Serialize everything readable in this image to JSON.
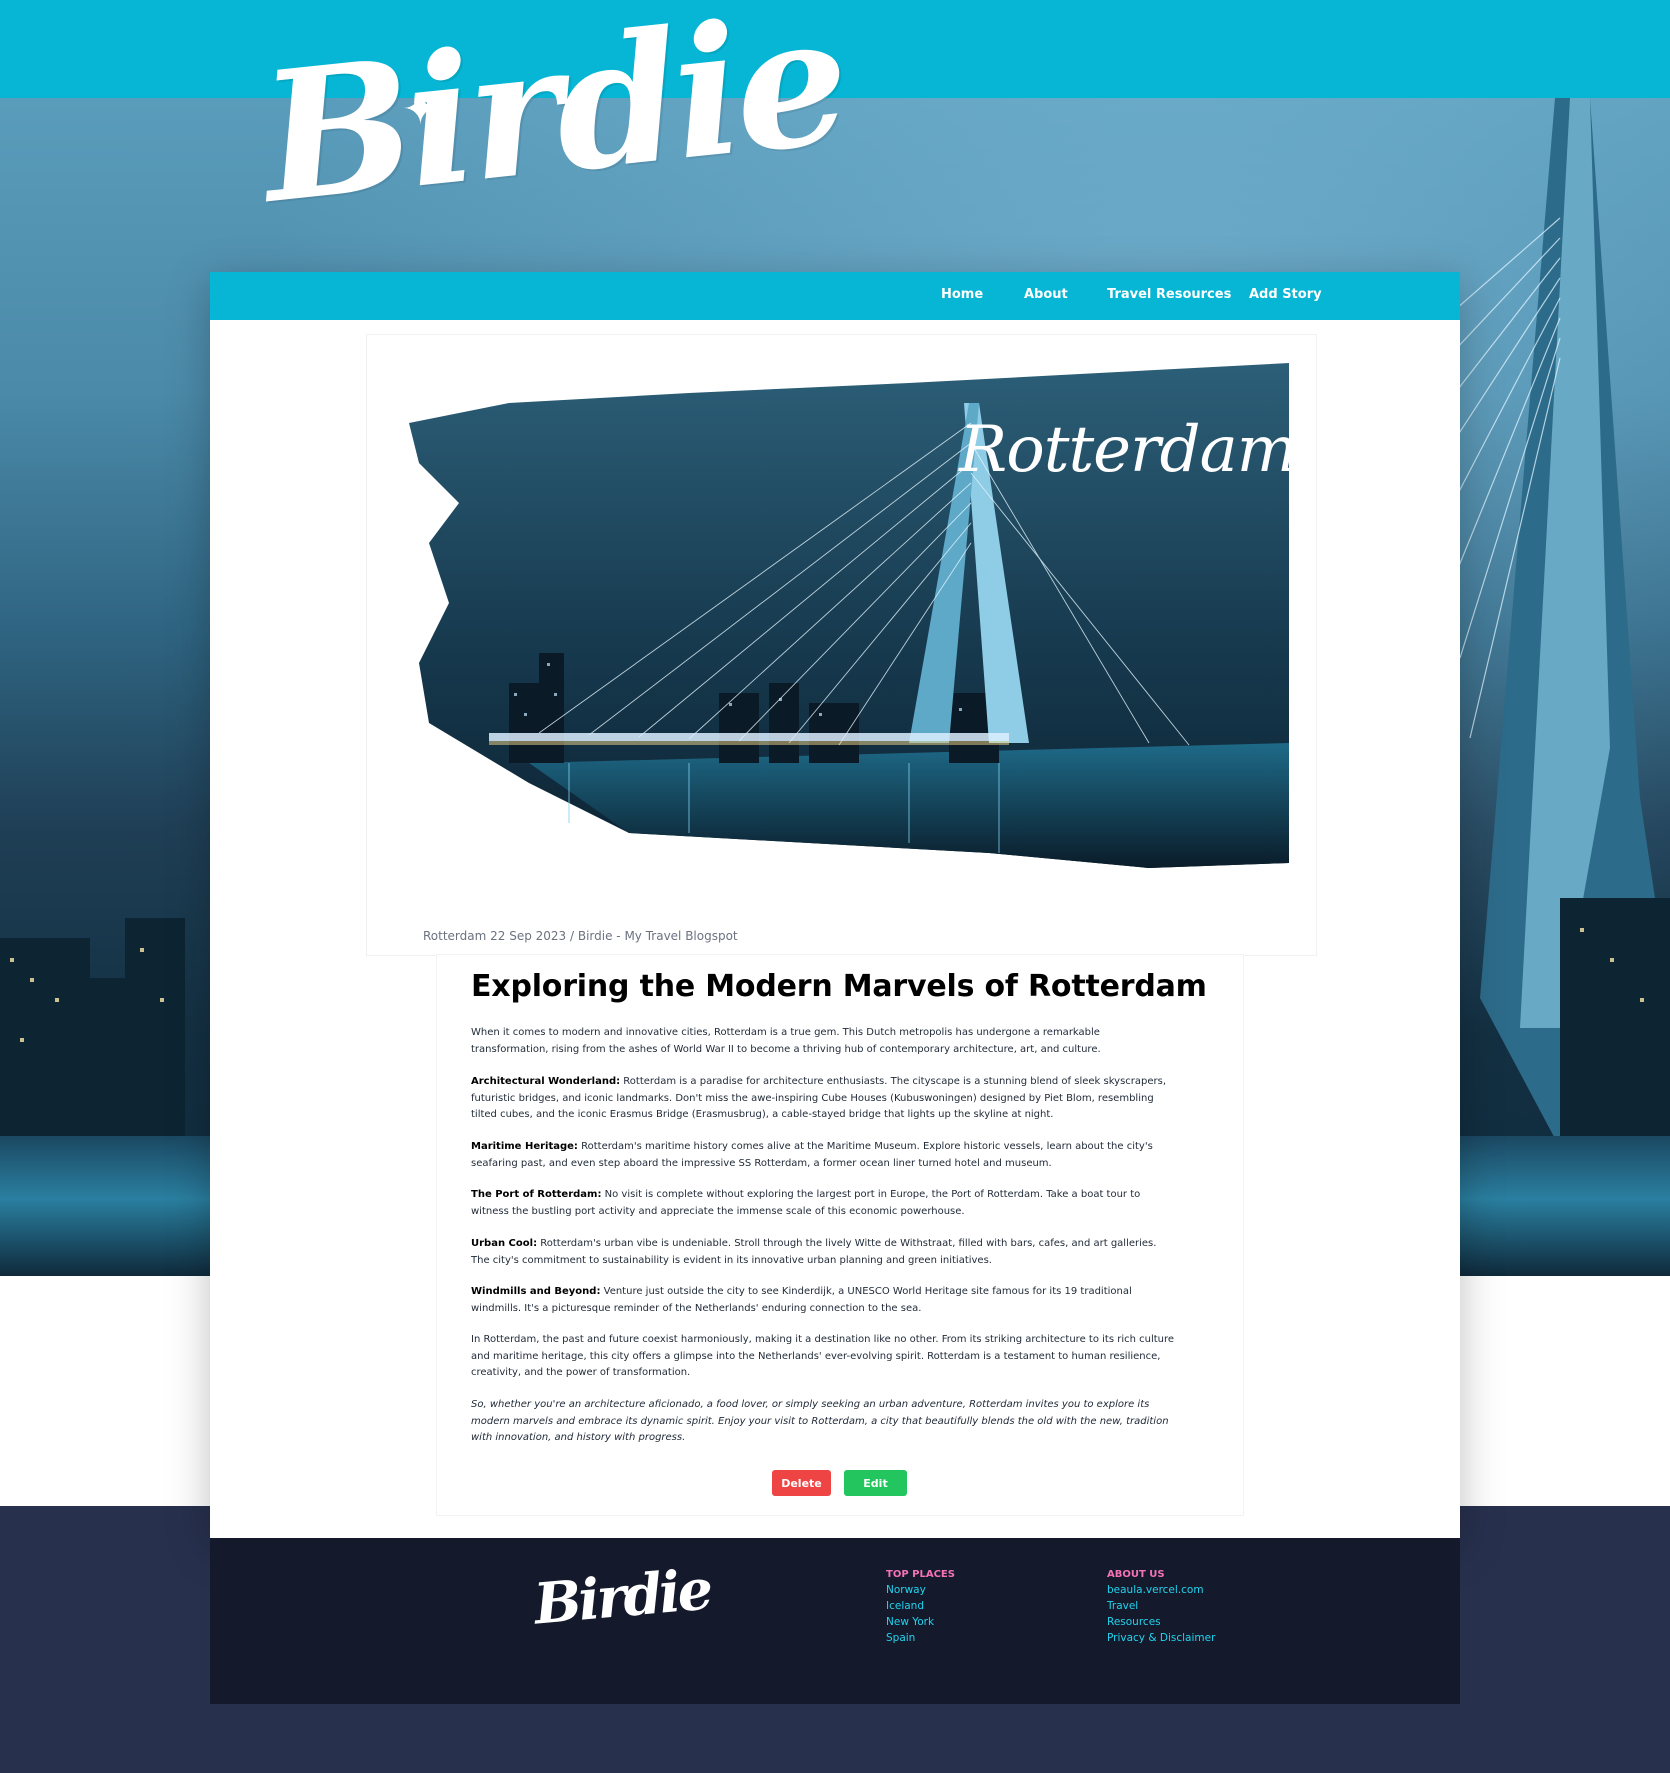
{
  "brand": {
    "name": "Birdie"
  },
  "nav": {
    "home": "Home",
    "about": "About",
    "travel_resources": "Travel Resources",
    "add_story": "Add Story"
  },
  "hero": {
    "image_title": "Rotterdam"
  },
  "post": {
    "meta": "Rotterdam  22 Sep 2023 / Birdie - My Travel Blogspot",
    "title": "Exploring the Modern Marvels of Rotterdam",
    "intro": "When it comes to modern and innovative cities, Rotterdam is a true gem. This Dutch metropolis has undergone a remarkable transformation, rising from the ashes of World War II to become a thriving hub of contemporary architecture, art, and culture.",
    "sections": [
      {
        "heading": "Architectural Wonderland:",
        "body": " Rotterdam is a paradise for architecture enthusiasts. The cityscape is a stunning blend of sleek skyscrapers, futuristic bridges, and iconic landmarks. Don't miss the awe-inspiring Cube Houses (Kubuswoningen) designed by Piet Blom, resembling tilted cubes, and the iconic Erasmus Bridge (Erasmusbrug), a cable-stayed bridge that lights up the skyline at night."
      },
      {
        "heading": "Maritime Heritage:",
        "body": " Rotterdam's maritime history comes alive at the Maritime Museum. Explore historic vessels, learn about the city's seafaring past, and even step aboard the impressive SS Rotterdam, a former ocean liner turned hotel and museum."
      },
      {
        "heading": "The Port of Rotterdam:",
        "body": " No visit is complete without exploring the largest port in Europe, the Port of Rotterdam. Take a boat tour to witness the bustling port activity and appreciate the immense scale of this economic powerhouse."
      },
      {
        "heading": "Urban Cool:",
        "body": " Rotterdam's urban vibe is undeniable. Stroll through the lively Witte de Withstraat, filled with bars, cafes, and art galleries. The city's commitment to sustainability is evident in its innovative urban planning and green initiatives."
      },
      {
        "heading": "Windmills and Beyond:",
        "body": " Venture just outside the city to see Kinderdijk, a UNESCO World Heritage site famous for its 19 traditional windmills. It's a picturesque reminder of the Netherlands' enduring connection to the sea."
      }
    ],
    "conclusion": "In Rotterdam, the past and future coexist harmoniously, making it a destination like no other. From its striking architecture to its rich culture and maritime heritage, this city offers a glimpse into the Netherlands' ever-evolving spirit. Rotterdam is a testament to human resilience, creativity, and the power of transformation.",
    "closing": "So, whether you're an architecture aficionado, a food lover, or simply seeking an urban adventure, Rotterdam invites you to explore its modern marvels and embrace its dynamic spirit. Enjoy your visit to Rotterdam, a city that beautifully blends the old with the new, tradition with innovation, and history with progress."
  },
  "actions": {
    "delete": "Delete",
    "edit": "Edit"
  },
  "footer": {
    "top_places_heading": "TOP PLACES",
    "top_places": [
      "Norway",
      "Iceland",
      "New York",
      "Spain"
    ],
    "about_heading": "ABOUT US",
    "about_links": [
      "beaula.vercel.com",
      "Travel",
      "Resources",
      "Privacy & Disclaimer"
    ]
  },
  "colors": {
    "accent": "#06b6d4",
    "delete": "#ef4444",
    "edit": "#22c55e",
    "footer_bg": "#141a2c",
    "footer_outer": "#27304d",
    "footer_heading": "#f472b6",
    "footer_link": "#22d3ee"
  }
}
